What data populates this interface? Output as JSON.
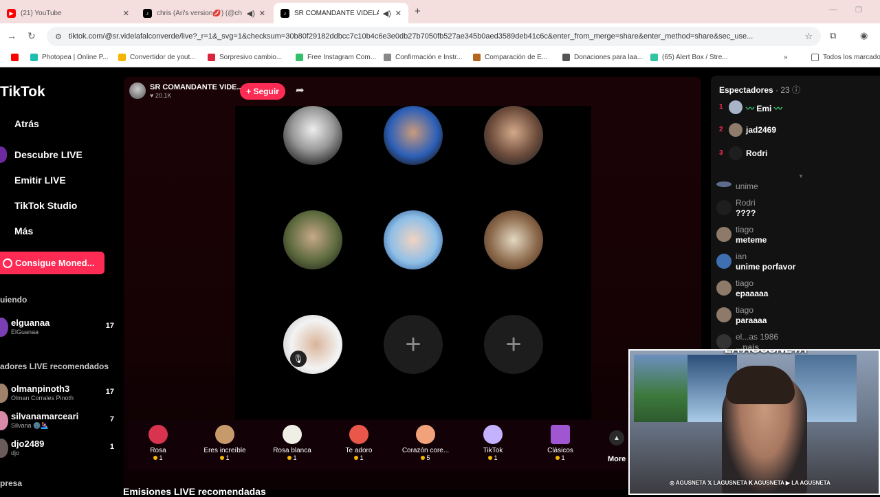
{
  "browser": {
    "tabs": [
      {
        "title": "(21) YouTube",
        "color": "#ff0000"
      },
      {
        "title": "chris (Ari's version💋) (@ch",
        "color": "#000000"
      },
      {
        "title": "SR COMANDANTE VIDELA",
        "color": "#000000"
      }
    ],
    "url": "tiktok.com/@sr.videlafalconverde/live?_r=1&_svg=1&checksum=30b80f29182ddbcc7c10b4c6e3e0db27b7050fb527ae345b0aed3589deb41c6c&enter_from_merge=share&enter_method=share&sec_use...",
    "bookmarks": [
      "Photopea | Online P...",
      "Convertidor de yout...",
      "Sorpresivo cambio...",
      "Free Instagram Com...",
      "Confirmación e Instr...",
      "Comparación de E...",
      "Donaciones para laa...",
      "(65) Alert Box / Stre..."
    ],
    "bookmarks_folder": "Todos los marcado"
  },
  "sidebar": {
    "logo": "TikTok",
    "back": "Atrás",
    "discover": "Descubre LIVE",
    "go_live": "Emitir LIVE",
    "studio": "TikTok Studio",
    "more": "Más",
    "coins": "Consigue Moned...",
    "following_title": "uiendo",
    "following": [
      {
        "name": "elguanaa",
        "sub": "ElGuanaa",
        "count": "17"
      }
    ],
    "recommended_title": "adores LIVE recomendados",
    "recommended": [
      {
        "name": "olmanpinoth3",
        "sub": "Olman Corrales Pinoth",
        "count": "17"
      },
      {
        "name": "silvanamarceari",
        "sub": "Silvana 🌚🤽🏼‍♀️",
        "count": "7"
      },
      {
        "name": "djo2489",
        "sub": "djo",
        "count": "1"
      }
    ],
    "footer_section": "presa"
  },
  "live": {
    "host_name": "SR COMANDANTE VIDE...",
    "host_likes": "20.1K",
    "follow": "+ Seguir",
    "gifts": [
      {
        "name": "Rosa",
        "price": "1",
        "color": "#d8344f"
      },
      {
        "name": "Eres increíble",
        "price": "1",
        "color": "#c79a6b"
      },
      {
        "name": "Rosa blanca",
        "price": "1",
        "color": "#f0efe6"
      },
      {
        "name": "Te adoro",
        "price": "1",
        "color": "#e9574b"
      },
      {
        "name": "Corazón core...",
        "price": "5",
        "color": "#f2a27a"
      },
      {
        "name": "TikTok",
        "price": "1",
        "color": "#c5b2ff"
      },
      {
        "name": "Clásicos",
        "price": "1",
        "color": "#a156d1"
      }
    ],
    "gifts_more": "More",
    "recommended_title": "Emisiones LIVE recomendadas"
  },
  "viewers": {
    "title": "Espectadores",
    "count": "· 23",
    "top": [
      {
        "rank": "1",
        "name": "Emi",
        "color": "#a8b4c8"
      },
      {
        "rank": "2",
        "name": "jad2469",
        "color": "#8e7b6a"
      },
      {
        "rank": "3",
        "name": "Rodri",
        "color": "#1e1e1e"
      }
    ],
    "chat": [
      {
        "user": "unime",
        "text": "",
        "color": "#5d6b8c"
      },
      {
        "user": "Rodri",
        "text": "????",
        "color": "#1e1e1e"
      },
      {
        "user": "tiago",
        "text": "meteme",
        "color": "#8d7a69"
      },
      {
        "user": "ian",
        "text": "unime porfavor",
        "color": "#3f6fb0"
      },
      {
        "user": "tiago",
        "text": "epaaaaa",
        "color": "#8d7a69"
      },
      {
        "user": "tiago",
        "text": "paraaaa",
        "color": "#8d7a69"
      },
      {
        "user": "el...as 1986",
        "text": "...pais",
        "color": "#333333"
      }
    ]
  },
  "webcam": {
    "brand": "LA AGUSNETA",
    "socials": "◎ AGUSNETA  𝕏 LAGUSNETA  𝐊 AGUSNETA  ▶ LA AGUSNETA"
  }
}
